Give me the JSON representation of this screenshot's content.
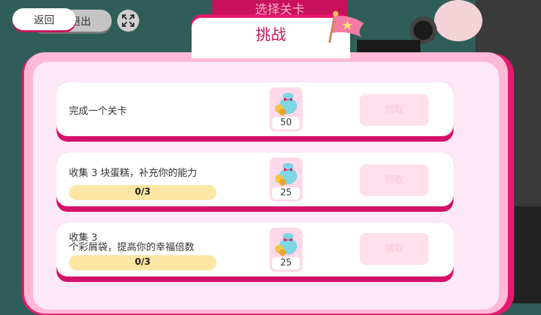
{
  "header": {
    "back_label": "返回",
    "exit_label": "退出",
    "fullscreen_icon": "fullscreen-icon",
    "bg_title": "选择关卡"
  },
  "tab": {
    "title": "挑战",
    "flag_icon": "star-flag-icon"
  },
  "tasks": [
    {
      "label": "完成一个关卡",
      "progress": "",
      "reward": "50",
      "claim_label": "领取"
    },
    {
      "label": "收集 3 块蛋糕，补充你的能力",
      "progress": "0/3",
      "reward": "25",
      "claim_label": "领取"
    },
    {
      "label_line1": "收集 3",
      "label_line2": "个彩屑袋，提高你的幸福倍数",
      "progress": "0/3",
      "reward": "25",
      "claim_label": "领取"
    }
  ],
  "colors": {
    "accent": "#e7186f",
    "panel": "#ffb9d6",
    "panel_inner": "#fce8f7",
    "progress": "#fbe7a3",
    "claim_disabled": "#ffe0ec"
  }
}
